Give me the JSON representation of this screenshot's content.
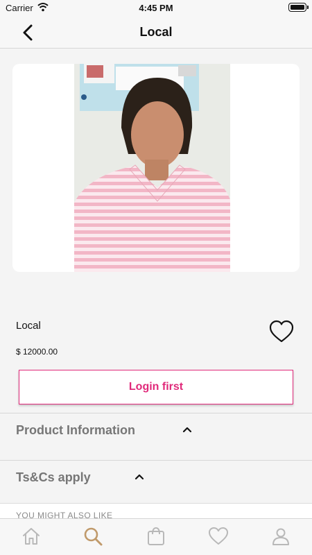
{
  "status_bar": {
    "carrier": "Carrier",
    "time": "4:45 PM"
  },
  "nav": {
    "title": "Local",
    "back_icon": "chevron-left-icon"
  },
  "product": {
    "name": "Local",
    "price": "$ 12000.00",
    "favorite_icon": "heart-outline-icon",
    "login_button": "Login first"
  },
  "sections": {
    "product_info": {
      "label": "Product Information",
      "icon": "chevron-up-icon"
    },
    "tcs": {
      "label": "Ts&Cs apply",
      "icon": "chevron-up-icon"
    }
  },
  "recommendations": {
    "heading": "YOU MIGHT ALSO LIKE"
  },
  "tab_bar": {
    "active_tab": "search",
    "tabs": [
      "home-icon",
      "search-icon",
      "bag-icon",
      "heart-icon",
      "profile-icon"
    ]
  },
  "colors": {
    "accent": "#e0297a",
    "tab_active": "#c09a6b",
    "tab_inactive": "#b8b8b8"
  }
}
